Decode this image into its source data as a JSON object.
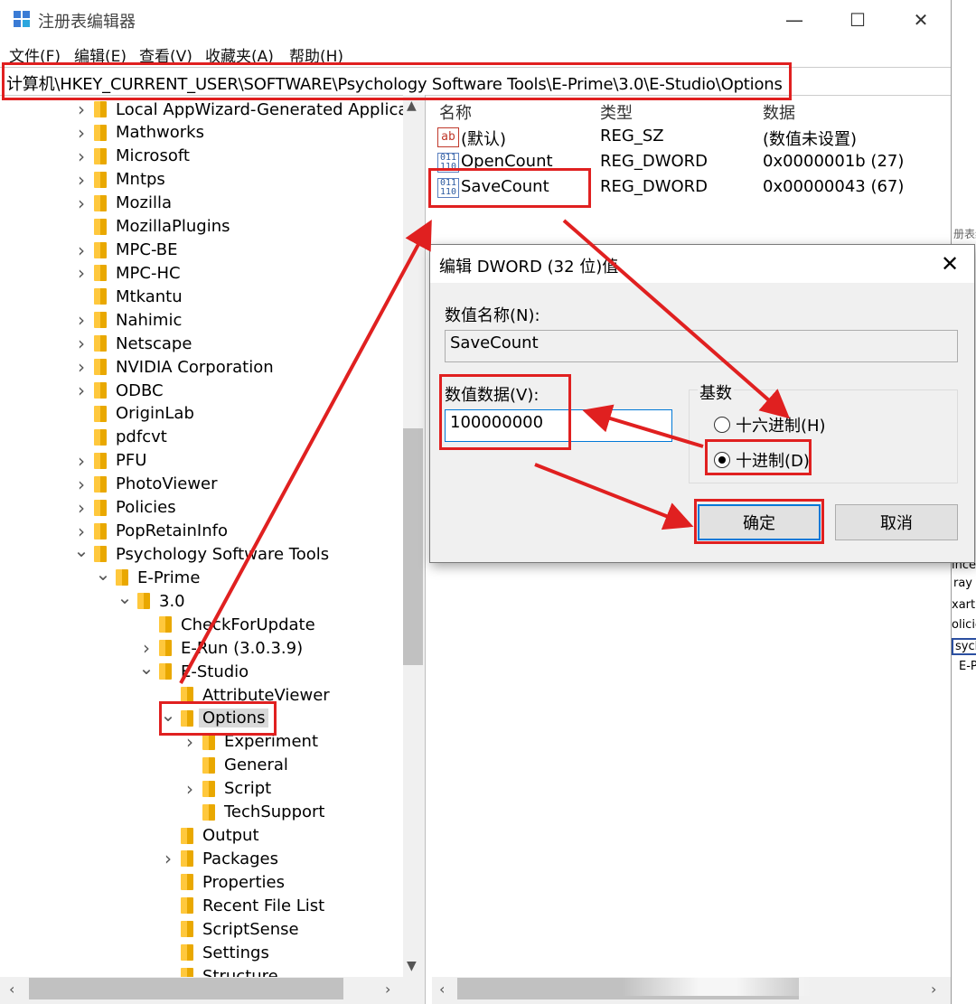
{
  "window": {
    "title": "注册表编辑器",
    "menu": [
      "文件(F)",
      "编辑(E)",
      "查看(V)",
      "收藏夹(A)",
      "帮助(H)"
    ],
    "address": "计算机\\HKEY_CURRENT_USER\\SOFTWARE\\Psychology Software Tools\\E-Prime\\3.0\\E-Studio\\Options"
  },
  "tree": {
    "items": [
      {
        "label": "Local AppWizard-Generated Applica",
        "expand": "closed"
      },
      {
        "label": "Mathworks",
        "expand": "closed"
      },
      {
        "label": "Microsoft",
        "expand": "closed"
      },
      {
        "label": "Mntps",
        "expand": "closed"
      },
      {
        "label": "Mozilla",
        "expand": "closed"
      },
      {
        "label": "MozillaPlugins",
        "expand": "none"
      },
      {
        "label": "MPC-BE",
        "expand": "closed"
      },
      {
        "label": "MPC-HC",
        "expand": "closed"
      },
      {
        "label": "Mtkantu",
        "expand": "none"
      },
      {
        "label": "Nahimic",
        "expand": "closed"
      },
      {
        "label": "Netscape",
        "expand": "closed"
      },
      {
        "label": "NVIDIA Corporation",
        "expand": "closed"
      },
      {
        "label": "ODBC",
        "expand": "closed"
      },
      {
        "label": "OriginLab",
        "expand": "none"
      },
      {
        "label": "pdfcvt",
        "expand": "none"
      },
      {
        "label": "PFU",
        "expand": "closed"
      },
      {
        "label": "PhotoViewer",
        "expand": "closed"
      },
      {
        "label": "Policies",
        "expand": "closed"
      },
      {
        "label": "PopRetainInfo",
        "expand": "closed"
      },
      {
        "label": "Psychology Software Tools",
        "expand": "open"
      },
      {
        "label": "E-Prime",
        "expand": "open"
      },
      {
        "label": "3.0",
        "expand": "open"
      },
      {
        "label": "CheckForUpdate",
        "expand": "none"
      },
      {
        "label": "E-Run (3.0.3.9)",
        "expand": "closed"
      },
      {
        "label": "E-Studio",
        "expand": "open"
      },
      {
        "label": "AttributeViewer",
        "expand": "none"
      },
      {
        "label": "Options",
        "expand": "open",
        "selected": true
      },
      {
        "label": "Experiment",
        "expand": "closed"
      },
      {
        "label": "General",
        "expand": "none"
      },
      {
        "label": "Script",
        "expand": "closed"
      },
      {
        "label": "TechSupport",
        "expand": "none"
      },
      {
        "label": "Output",
        "expand": "none"
      },
      {
        "label": "Packages",
        "expand": "closed"
      },
      {
        "label": "Properties",
        "expand": "none"
      },
      {
        "label": "Recent File List",
        "expand": "none"
      },
      {
        "label": "ScriptSense",
        "expand": "none"
      },
      {
        "label": "Settings",
        "expand": "none"
      },
      {
        "label": "Structure",
        "expand": "none"
      }
    ]
  },
  "values": {
    "headers": {
      "name": "名称",
      "type": "类型",
      "data": "数据"
    },
    "rows": [
      {
        "icon": "string-value-icon",
        "name": "(默认)",
        "type": "REG_SZ",
        "data": "(数值未设置)"
      },
      {
        "icon": "dword-value-icon",
        "name": "OpenCount",
        "type": "REG_DWORD",
        "data": "0x0000001b (27)"
      },
      {
        "icon": "dword-value-icon",
        "name": "SaveCount",
        "type": "REG_DWORD",
        "data": "0x00000043 (67)"
      }
    ]
  },
  "dialog": {
    "title": "编辑 DWORD (32 位)值",
    "name_label": "数值名称(N):",
    "name_value": "SaveCount",
    "data_label": "数值数据(V):",
    "data_value": "100000000",
    "base_label": "基数",
    "radio_hex": "十六进制(H)",
    "radio_dec": "十进制(D)",
    "base_selected": "decimal",
    "ok": "确定",
    "cancel": "取消"
  },
  "ghost_window": {
    "title_fragment": "册表编",
    "items": [
      "ince",
      "ray",
      "xart",
      "olicie",
      "sych",
      "E-P"
    ]
  },
  "colors": {
    "annotation": "#e02020",
    "focus": "#0078d7",
    "folder": "#ffc83d"
  }
}
